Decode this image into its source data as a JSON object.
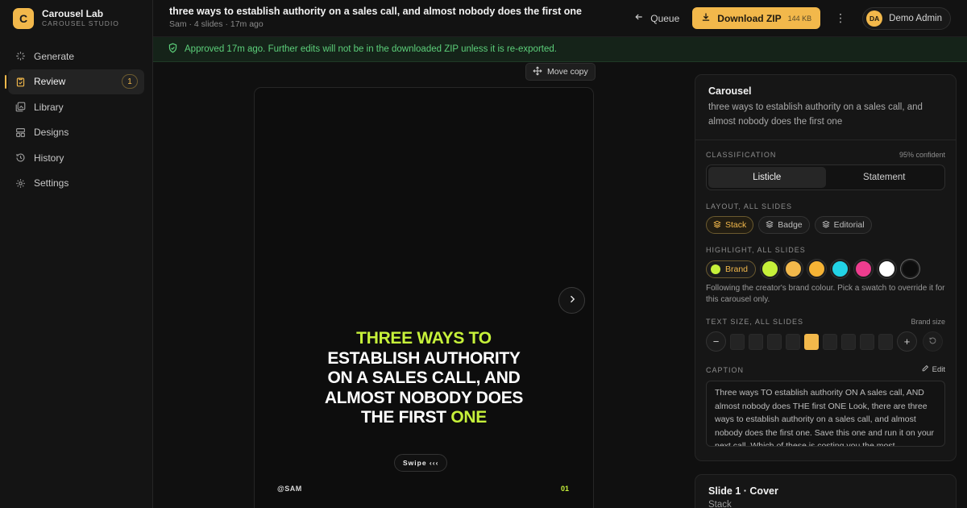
{
  "app": {
    "name": "Carousel Lab",
    "subtitle": "CAROUSEL STUDIO",
    "logo_letter": "C"
  },
  "sidebar": {
    "items": [
      {
        "label": "Generate",
        "icon": "sparkle-icon"
      },
      {
        "label": "Review",
        "icon": "clipboard-check-icon",
        "badge": "1",
        "active": true
      },
      {
        "label": "Library",
        "icon": "images-icon"
      },
      {
        "label": "Designs",
        "icon": "layout-icon"
      },
      {
        "label": "History",
        "icon": "history-icon"
      },
      {
        "label": "Settings",
        "icon": "gear-icon"
      }
    ]
  },
  "header": {
    "title": "three ways to establish authority on a sales call, and almost nobody does the first one",
    "meta": "Sam · 4 slides · 17m ago",
    "queue_label": "Queue",
    "download_label": "Download ZIP",
    "download_size": "144 KB",
    "user_initials": "DA",
    "user_name": "Demo Admin"
  },
  "banner": {
    "text": "Approved 17m ago. Further edits will not be in the downloaded ZIP unless it is re-exported."
  },
  "canvas": {
    "move_copy_label": "Move copy",
    "slide": {
      "headline_1": "THREE WAYS TO",
      "headline_2": "ESTABLISH AUTHORITY",
      "headline_3": "ON A SALES CALL, AND",
      "headline_4": "ALMOST NOBODY DOES",
      "headline_5a": "THE FIRST ",
      "headline_5b": "ONE",
      "swipe": "Swipe ‹‹‹",
      "handle": "@SAM",
      "number": "01"
    }
  },
  "panel": {
    "title": "Carousel",
    "description": "three ways to establish authority on a sales call, and almost nobody does the first one",
    "classification_label": "CLASSIFICATION",
    "confidence": "95% confident",
    "classification_options": [
      "Listicle",
      "Statement"
    ],
    "layout_label": "LAYOUT, ALL SLIDES",
    "layout_options": [
      "Stack",
      "Badge",
      "Editorial"
    ],
    "highlight_label": "HIGHLIGHT, ALL SLIDES",
    "brand_label": "Brand",
    "swatches": [
      "#c6f13a",
      "#f2b84b",
      "#f5b335",
      "#22d3e6",
      "#ee3d8f",
      "#ffffff",
      "#0d0d0d"
    ],
    "highlight_hint": "Following the creator's brand colour. Pick a swatch to override it for this carousel only.",
    "text_size_label": "TEXT SIZE, ALL SLIDES",
    "text_size_right": "Brand size",
    "text_size_level": 5,
    "text_size_steps": 9,
    "caption_label": "CAPTION",
    "caption_edit": "Edit",
    "caption_text": "Three ways TO establish authority ON A sales call, AND almost nobody does THE first ONE Look, there are three ways to establish authority on a sales call, and almost nobody does the first one. Save this one and run it on your next call. Which of these is costing you the most"
  },
  "panel2": {
    "title": "Slide 1 · Cover",
    "subtitle": "Stack"
  },
  "colors": {
    "accent": "#f2b84b",
    "highlight": "#c6f13a",
    "success": "#5ccf7a"
  }
}
